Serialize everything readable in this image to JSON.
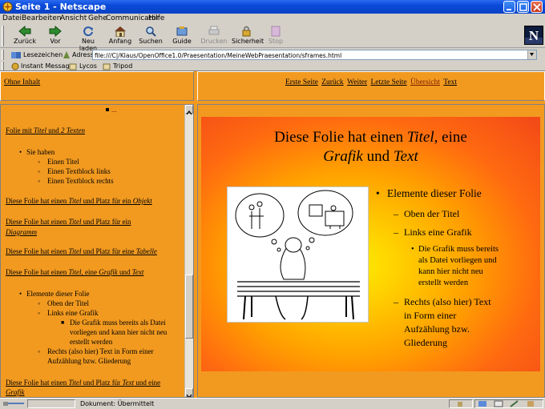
{
  "window": {
    "title": "Seite 1 - Netscape"
  },
  "menu": [
    "Datei",
    "Bearbeiten",
    "Ansicht",
    "Gehe",
    "Communicator",
    "Hilfe"
  ],
  "toolbar": {
    "buttons": [
      {
        "label": "Zurück",
        "icon": "back-arrow-icon"
      },
      {
        "label": "Vor",
        "icon": "forward-arrow-icon"
      },
      {
        "label": "Neu laden",
        "icon": "reload-icon"
      },
      {
        "label": "Anfang",
        "icon": "home-icon"
      },
      {
        "label": "Suchen",
        "icon": "search-icon"
      },
      {
        "label": "Guide",
        "icon": "guide-icon"
      },
      {
        "label": "Drucken",
        "icon": "print-icon",
        "disabled": true
      },
      {
        "label": "Sicherheit",
        "icon": "lock-icon"
      },
      {
        "label": "Stop",
        "icon": "stop-icon",
        "disabled": true
      }
    ]
  },
  "location": {
    "bookmarks_label": "Lesezeichen",
    "address_label": "Adresse:",
    "url": "file:///C|/Klaus/OpenOffice1.0/Praesentation/MeineWebPraesentation/sframes.html"
  },
  "personal_toolbar": [
    "Instant Message",
    "Lycos",
    "Tripod"
  ],
  "top_left": {
    "link": "Ohne Inhalt"
  },
  "top_right": {
    "nav": [
      "Erste Seite",
      "Zurück",
      "Weiter",
      "Letzte Seite",
      "Übersicht",
      "Text"
    ]
  },
  "outline": {
    "ellipsis": "...",
    "slide1_title": [
      "Folie mit ",
      "Titel",
      " und ",
      "2 Texten"
    ],
    "slide1_bullets": [
      "Sie haben",
      "Einen Titel",
      "Einen Textblock links",
      "Einen Textblock rechts"
    ],
    "slide2_line1": [
      "Diese Folie hat einen ",
      "Titel",
      " und Platz für ein ",
      "Objekt"
    ],
    "slide3_line1": "Diese Folie hat einen ",
    "slide3_titel": "Titel",
    "slide3_line1b": " und Platz für ein",
    "slide3_line2": "Diagramm",
    "slide4_line1": [
      "Diese Folie hat einen ",
      "Titel",
      " und Platz für eine ",
      "Tabelle"
    ],
    "slide5_line1": [
      "Diese Folie hat einen ",
      "Titel",
      ", eine ",
      "Grafik",
      " und ",
      "Text"
    ],
    "slide5_bullets": [
      "Elemente dieser Folie",
      "Oben der Titel",
      "Links eine Grafik",
      "Die Grafik muss bereits als Datei",
      "vorliegen und kann hier nicht neu",
      "erstellt werden",
      "Rechts (also hier) Text in Form einer",
      "Aufzählung bzw. Gliederung"
    ],
    "slide6_line1": [
      "Diese Folie hat einen ",
      "Titel",
      " und Platz für ",
      "Text",
      " und eine"
    ],
    "slide6_line2": "Grafik"
  },
  "slide": {
    "title_line1_a": "Diese Folie hat einen ",
    "title_line1_b": "Titel",
    "title_line1_c": ", eine",
    "title_line2_a": "Grafik",
    "title_line2_b": " und ",
    "title_line2_c": "Text",
    "bullets": {
      "l1": "Elemente dieser Folie",
      "l2a": "Oben der Titel",
      "l2b": "Links eine Grafik",
      "l3a": "Die Grafik muss bereits",
      "l3b": "als Datei vorliegen und",
      "l3c": "kann hier nicht neu",
      "l3d": "erstellt werden",
      "l2c1": "Rechts (also hier) Text",
      "l2c2": "in Form einer",
      "l2c3": "Aufzählung bzw.",
      "l2c4": "Gliederung"
    }
  },
  "status": {
    "text": "Dokument: Übermittelt"
  }
}
